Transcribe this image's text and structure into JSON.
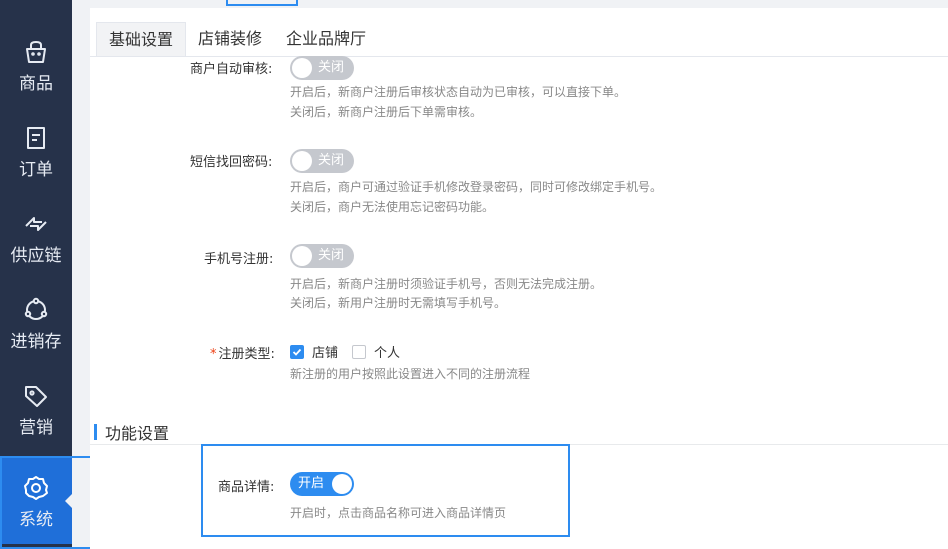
{
  "sidebar": {
    "items": [
      {
        "label": "商品",
        "icon": "basket-icon"
      },
      {
        "label": "订单",
        "icon": "order-icon"
      },
      {
        "label": "供应链",
        "icon": "transfer-icon"
      },
      {
        "label": "进销存",
        "icon": "inventory-icon"
      },
      {
        "label": "营销",
        "icon": "tag-icon"
      },
      {
        "label": "系统",
        "icon": "gear-icon",
        "active": true
      }
    ]
  },
  "tabs": [
    "基础设置",
    "店铺装修",
    "企业品牌厅"
  ],
  "settings": {
    "merchant_audit": {
      "label": "商户自动审核:",
      "switch_text": "关闭",
      "desc1": "开启后，新商户注册后审核状态自动为已审核，可以直接下单。",
      "desc2": "关闭后，新商户注册后下单需审核。"
    },
    "sms_reset": {
      "label": "短信找回密码:",
      "switch_text": "关闭",
      "desc1": "开启后，商户可通过验证手机修改登录密码，同时可修改绑定手机号。",
      "desc2": "关闭后，商户无法使用忘记密码功能。"
    },
    "phone_register": {
      "label": "手机号注册:",
      "switch_text": "关闭",
      "desc1": "开启后，新商户注册时须验证手机号，否则无法完成注册。",
      "desc2": "关闭后，新用户注册时无需填写手机号。"
    },
    "register_type": {
      "required_mark": "*",
      "label": "注册类型:",
      "options": [
        {
          "label": "店铺",
          "checked": true
        },
        {
          "label": "个人",
          "checked": false
        }
      ],
      "desc": "新注册的用户按照此设置进入不同的注册流程"
    }
  },
  "function_section": {
    "title": "功能设置",
    "product_detail": {
      "label": "商品详情:",
      "switch_text": "开启",
      "desc": "开启时，点击商品名称可进入商品详情页"
    }
  },
  "colors": {
    "accent": "#2d8cf0",
    "sidebar_bg": "#26324a",
    "active_nav": "#1f6fd9"
  }
}
